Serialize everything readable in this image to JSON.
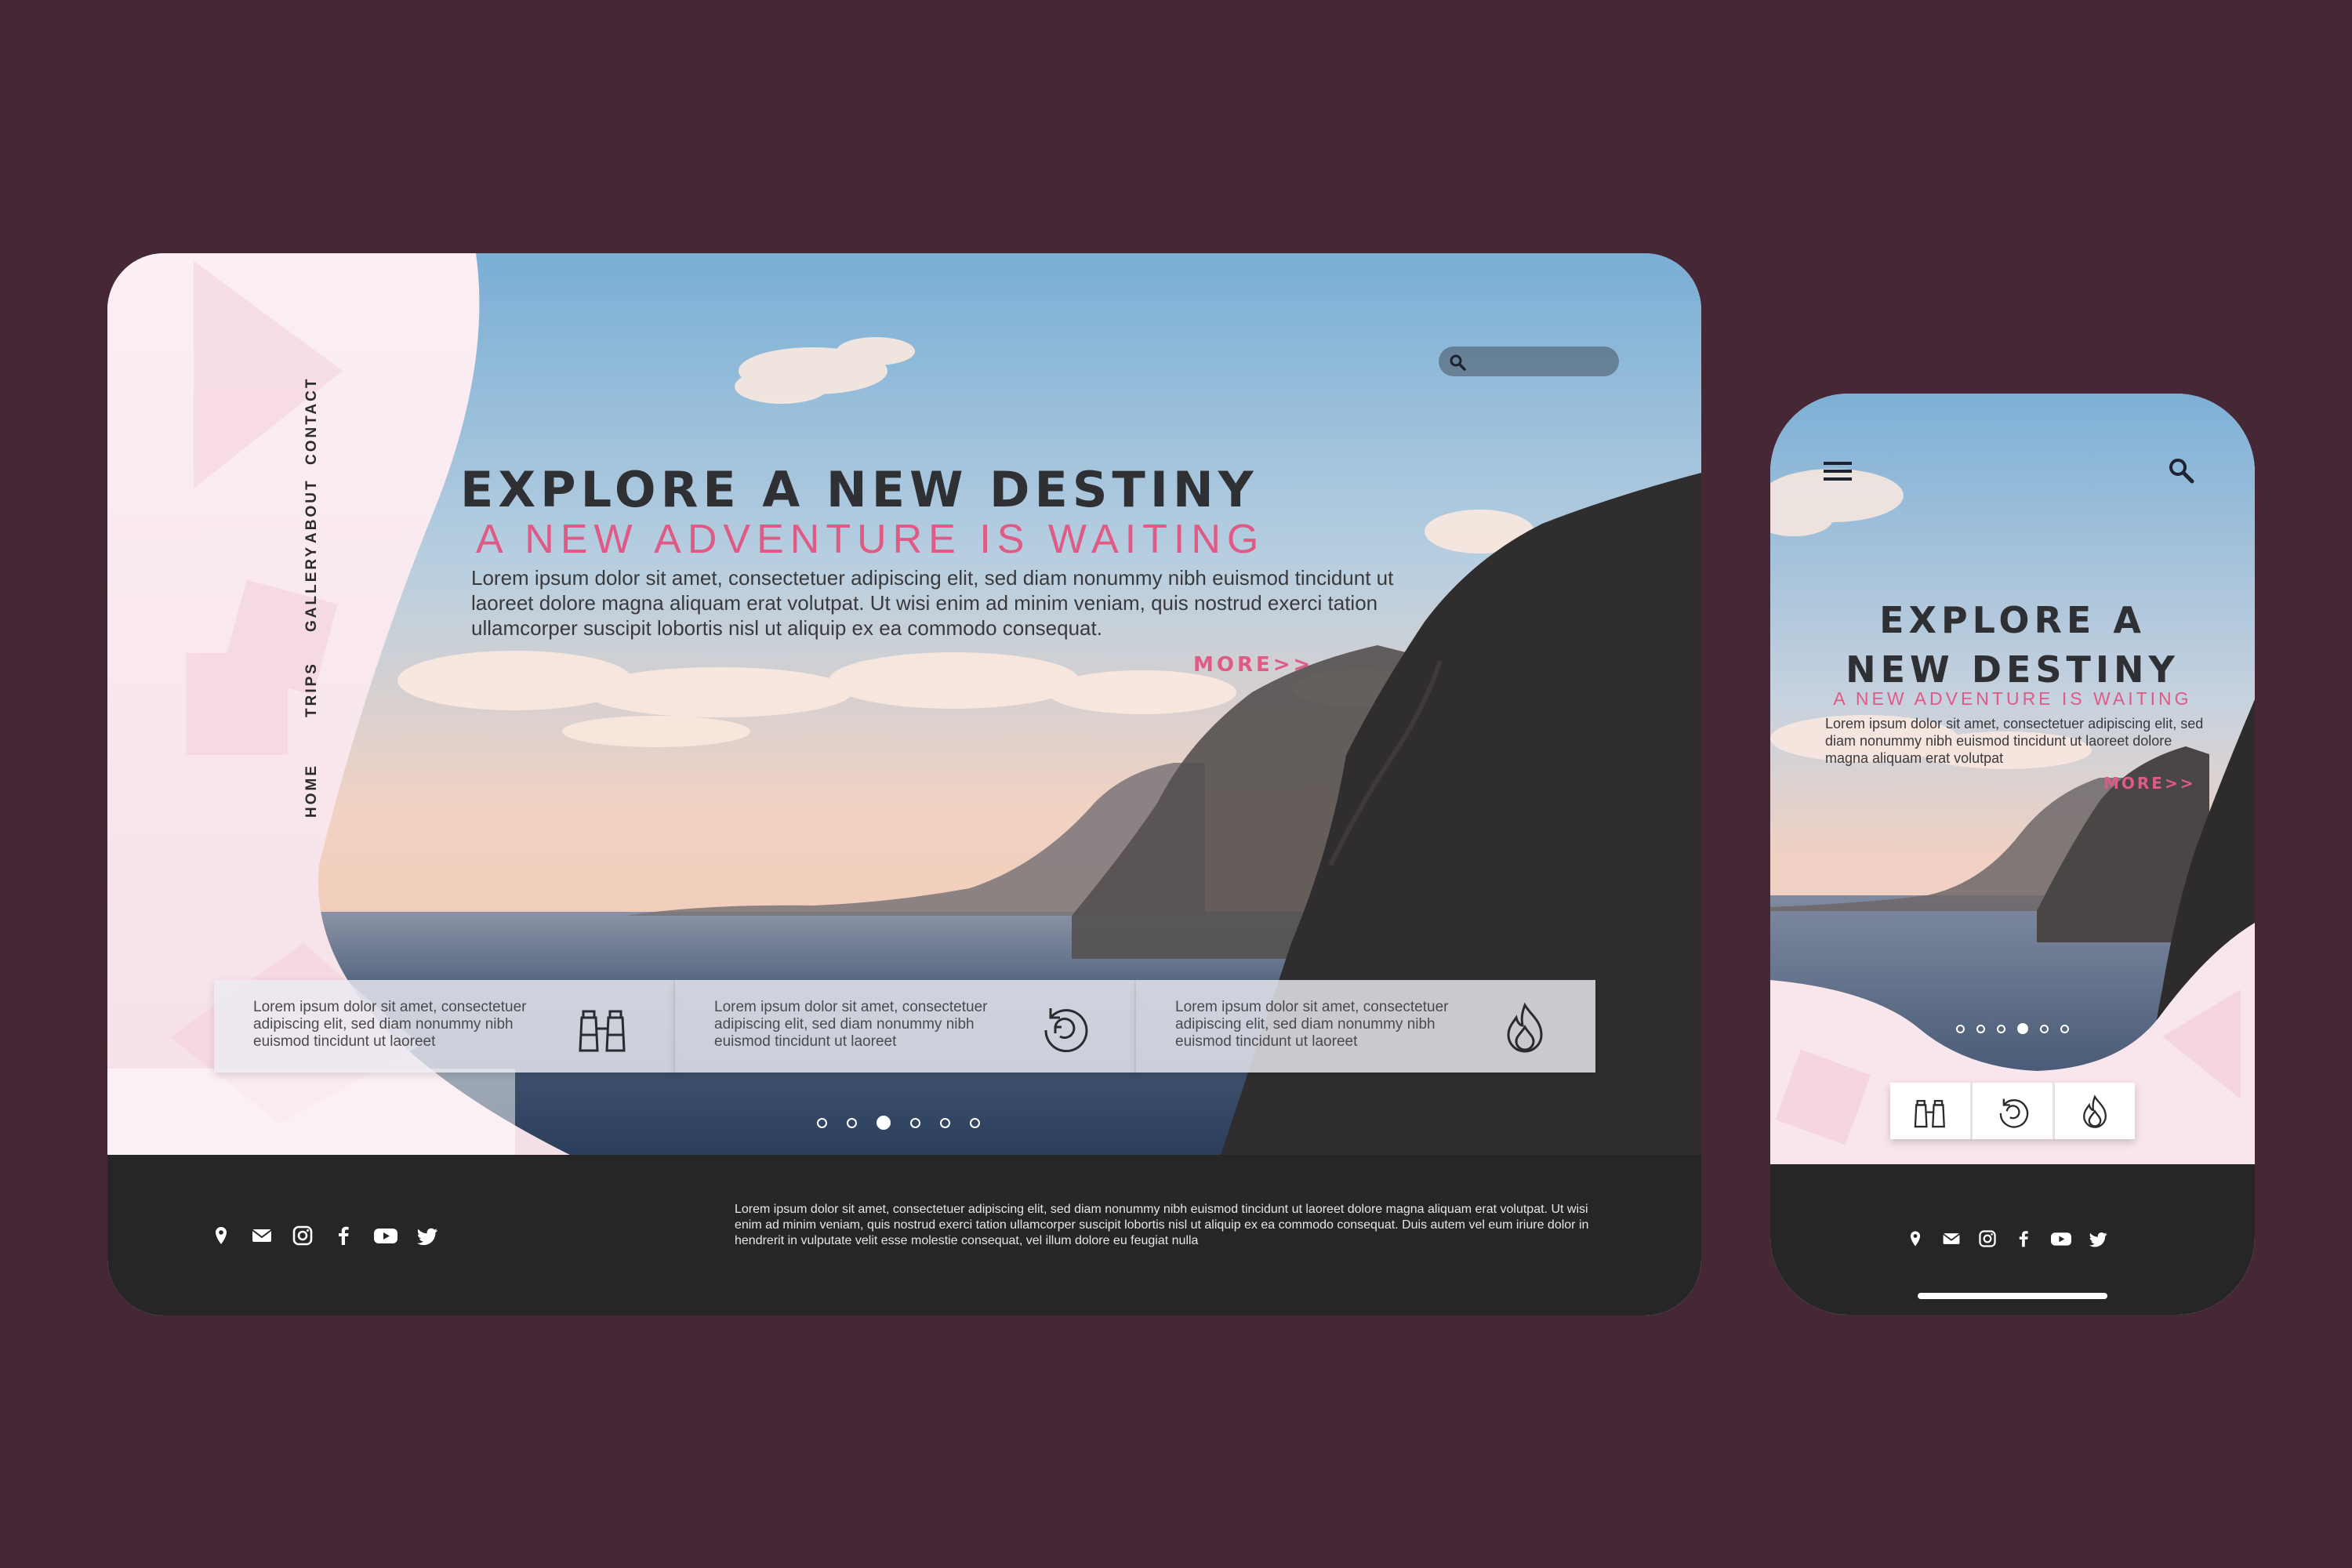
{
  "desktop": {
    "nav": [
      "HOME",
      "TRIPS",
      "GALLERY",
      "ABOUT",
      "CONTACT"
    ],
    "search": {
      "icon": "search-icon"
    },
    "hero": {
      "title": "EXPLORE A NEW DESTINY",
      "subtitle": "A NEW ADVENTURE IS WAITING",
      "body": "Lorem ipsum dolor sit amet, consectetuer adipiscing elit, sed diam nonummy nibh euismod tincidunt ut laoreet dolore magna aliquam erat volutpat. Ut wisi enim ad minim veniam, quis nostrud exerci tation ullamcorper suscipit lobortis nisl ut aliquip ex ea commodo consequat.",
      "more": "MORE>>"
    },
    "cards": [
      {
        "text": "Lorem ipsum dolor sit amet, consectetuer adipiscing elit, sed diam nonummy nibh euismod tincidunt ut laoreet",
        "icon": "binoculars-icon"
      },
      {
        "text": "Lorem ipsum dolor sit amet, consectetuer adipiscing elit, sed diam nonummy nibh euismod tincidunt ut laoreet",
        "icon": "refresh-icon"
      },
      {
        "text": "Lorem ipsum dolor sit amet, consectetuer adipiscing elit, sed diam nonummy nibh euismod tincidunt ut laoreet",
        "icon": "fire-icon"
      }
    ],
    "carousel": {
      "count": 6,
      "active": 3
    },
    "footer": {
      "social_icons": [
        "location-icon",
        "mail-icon",
        "instagram-icon",
        "facebook-icon",
        "youtube-icon",
        "twitter-icon"
      ],
      "text": "Lorem ipsum dolor sit amet, consectetuer adipiscing elit, sed diam nonummy nibh euismod tincidunt ut laoreet dolore magna aliquam erat volutpat. Ut wisi enim ad minim veniam, quis nostrud exerci tation ullamcorper suscipit lobortis nisl ut aliquip ex ea commodo consequat. Duis autem vel eum iriure dolor in hendrerit in vulputate velit esse molestie consequat, vel illum dolore eu feugiat nulla"
    }
  },
  "mobile": {
    "menu_icon": "hamburger-menu-icon",
    "search_icon": "search-icon",
    "hero": {
      "title_line1": "EXPLORE A",
      "title_line2": "NEW DESTINY",
      "subtitle": "A NEW ADVENTURE IS WAITING",
      "body": "Lorem ipsum dolor sit amet, consectetuer adipiscing elit, sed diam nonummy nibh euismod tincidunt ut laoreet dolore magna aliquam erat volutpat",
      "more": "MORE>>"
    },
    "carousel": {
      "count": 5,
      "active": 4
    },
    "cards": [
      "binoculars-icon",
      "refresh-icon",
      "fire-icon"
    ],
    "footer": {
      "social_icons": [
        "location-icon",
        "mail-icon",
        "instagram-icon",
        "facebook-icon",
        "youtube-icon",
        "twitter-icon"
      ]
    }
  },
  "colors": {
    "background": "#452735",
    "accent_pink": "#e05a86",
    "title_dark": "#2f3034",
    "footer_dark": "#272627",
    "panel_pink": "#f7e9ee"
  }
}
